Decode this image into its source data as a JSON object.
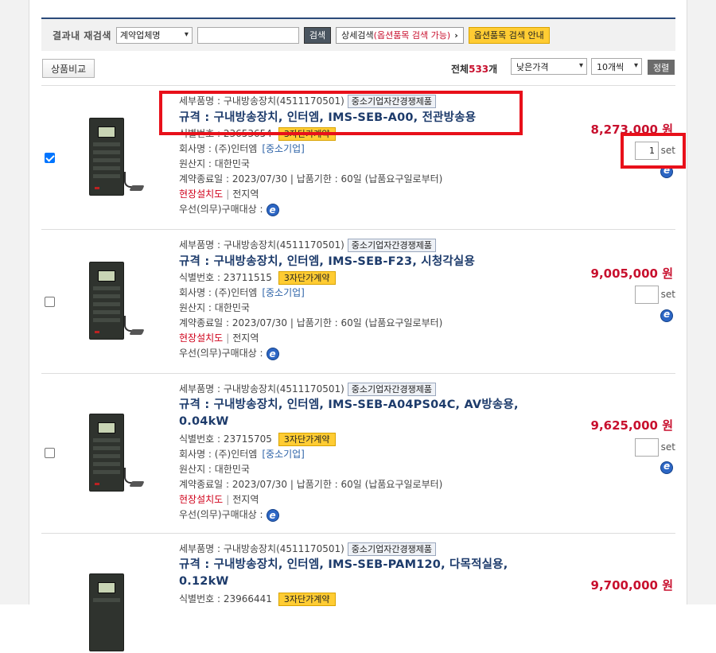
{
  "search": {
    "label": "결과내 재검색",
    "field_select": "계약업체명",
    "query_value": "",
    "search_button": "검색",
    "detail_search_prefix": "상세검색",
    "detail_search_option": "(옵션품목 검색 가능)",
    "detail_search_arrow": "›",
    "option_guide": "옵션품목 검색 안내"
  },
  "toolbar": {
    "compare_button": "상품비교",
    "total_prefix": "전체",
    "total_count": "533",
    "total_suffix": "개",
    "sort_by": "낮은가격",
    "per_page": "10개씩",
    "sort_button": "정렬"
  },
  "products": [
    {
      "checked": true,
      "category": "세부품명 : 구내방송장치(4511170501)",
      "sme_tag": "중소기업자간경쟁제품",
      "spec": "규격 : 구내방송장치, 인터엠, IMS-SEB-A00, 전관방송용",
      "id_text": "식별번호 : 23653654",
      "contract_tag": "3자단가계약",
      "company": "회사명 : (주)인터엠",
      "company_tag": "[중소기업]",
      "origin": "원산지 : 대한민국",
      "contract_dates": "계약종료일 : 2023/07/30 | 납품기한 : 60일 (납품요구일로부터)",
      "install": "현장설치도",
      "region": "전지역",
      "priority": "우선(의무)구매대상 :",
      "price": "8,273,000 원",
      "qty": "1",
      "unit": "set"
    },
    {
      "checked": false,
      "category": "세부품명 : 구내방송장치(4511170501)",
      "sme_tag": "중소기업자간경쟁제품",
      "spec": "규격 : 구내방송장치, 인터엠, IMS-SEB-F23, 시청각실용",
      "id_text": "식별번호 : 23711515",
      "contract_tag": "3자단가계약",
      "company": "회사명 : (주)인터엠",
      "company_tag": "[중소기업]",
      "origin": "원산지 : 대한민국",
      "contract_dates": "계약종료일 : 2023/07/30 | 납품기한 : 60일 (납품요구일로부터)",
      "install": "현장설치도",
      "region": "전지역",
      "priority": "우선(의무)구매대상 :",
      "price": "9,005,000 원",
      "qty": "",
      "unit": "set"
    },
    {
      "checked": false,
      "category": "세부품명 : 구내방송장치(4511170501)",
      "sme_tag": "중소기업자간경쟁제품",
      "spec": "규격 : 구내방송장치, 인터엠, IMS-SEB-A04PS04C, AV방송용, 0.04kW",
      "id_text": "식별번호 : 23715705",
      "contract_tag": "3자단가계약",
      "company": "회사명 : (주)인터엠",
      "company_tag": "[중소기업]",
      "origin": "원산지 : 대한민국",
      "contract_dates": "계약종료일 : 2023/07/30 | 납품기한 : 60일 (납품요구일로부터)",
      "install": "현장설치도",
      "region": "전지역",
      "priority": "우선(의무)구매대상 :",
      "price": "9,625,000 원",
      "qty": "",
      "unit": "set"
    },
    {
      "checked": false,
      "category": "세부품명 : 구내방송장치(4511170501)",
      "sme_tag": "중소기업자간경쟁제품",
      "spec": "규격 : 구내방송장치, 인터엠, IMS-SEB-PAM120, 다목적실용, 0.12kW",
      "id_text": "식별번호 : 23966441",
      "contract_tag": "3자단가계약",
      "price": "9,700,000 원"
    }
  ],
  "colors": {
    "accent_navy": "#1d3b6b",
    "price_red": "#c8102e",
    "tag_yellow": "#ffcc33",
    "highlight_red": "#e8101a"
  }
}
